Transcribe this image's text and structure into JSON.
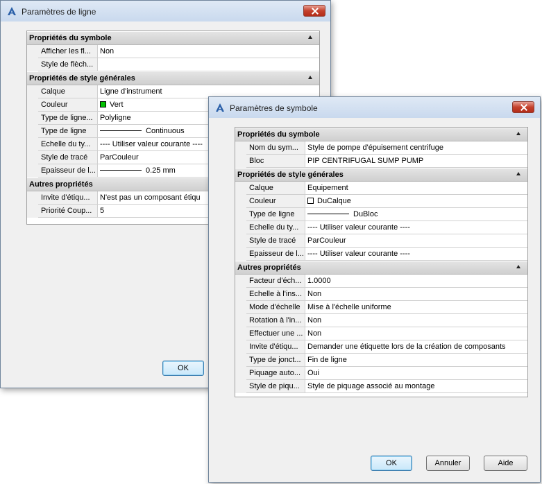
{
  "window1": {
    "title": "Paramètres de ligne",
    "ok_label": "OK",
    "categories": [
      {
        "label": "Propriétés du symbole",
        "rows": [
          {
            "name": "Afficher les fl...",
            "value": "Non"
          },
          {
            "name": "Style de flèch...",
            "value": ""
          }
        ]
      },
      {
        "label": "Propriétés de style générales",
        "rows": [
          {
            "name": "Calque",
            "value": "Ligne d'instrument"
          },
          {
            "name": "Couleur",
            "value": "Vert",
            "swatch": "#00c000"
          },
          {
            "name": "Type de ligne...",
            "value": "Polyligne"
          },
          {
            "name": "Type de ligne",
            "value": "Continuous",
            "line": true
          },
          {
            "name": "Echelle du ty...",
            "value": "---- Utiliser valeur courante ----"
          },
          {
            "name": "Style de tracé",
            "value": "ParCouleur"
          },
          {
            "name": "Epaisseur de l...",
            "value": "0.25 mm",
            "line": true
          }
        ]
      },
      {
        "label": "Autres propriétés",
        "rows": [
          {
            "name": "Invite d'étiqu...",
            "value": "N'est pas un composant étiqu"
          },
          {
            "name": "Priorité Coup...",
            "value": "5"
          }
        ]
      }
    ]
  },
  "window2": {
    "title": "Paramètres de symbole",
    "buttons": {
      "ok": "OK",
      "cancel": "Annuler",
      "help": "Aide"
    },
    "categories": [
      {
        "label": "Propriétés du symbole",
        "rows": [
          {
            "name": "Nom du sym...",
            "value": "Style de pompe d'épuisement centrifuge"
          },
          {
            "name": "Bloc",
            "value": "PIP CENTRIFUGAL SUMP PUMP"
          }
        ]
      },
      {
        "label": "Propriétés de style générales",
        "rows": [
          {
            "name": "Calque",
            "value": "Equipement"
          },
          {
            "name": "Couleur",
            "value": "DuCalque",
            "swatch": "#ffffff"
          },
          {
            "name": "Type de ligne",
            "value": "DuBloc",
            "line": true
          },
          {
            "name": "Echelle du ty...",
            "value": "---- Utiliser valeur courante ----"
          },
          {
            "name": "Style de tracé",
            "value": "ParCouleur"
          },
          {
            "name": "Epaisseur de l...",
            "value": "---- Utiliser valeur courante ----"
          }
        ]
      },
      {
        "label": "Autres propriétés",
        "rows": [
          {
            "name": "Facteur d'éch...",
            "value": "1.0000"
          },
          {
            "name": "Echelle à l'ins...",
            "value": "Non"
          },
          {
            "name": "Mode d'échelle",
            "value": "Mise à l'échelle uniforme"
          },
          {
            "name": "Rotation à l'in...",
            "value": "Non"
          },
          {
            "name": "Effectuer une ...",
            "value": "Non"
          },
          {
            "name": "Invite d'étiqu...",
            "value": "Demander une étiquette lors de la création de composants"
          },
          {
            "name": "Type de jonct...",
            "value": "Fin de ligne"
          },
          {
            "name": "Piquage auto...",
            "value": "Oui"
          },
          {
            "name": "Style de piqu...",
            "value": "Style de piquage associé au montage"
          }
        ]
      }
    ]
  }
}
